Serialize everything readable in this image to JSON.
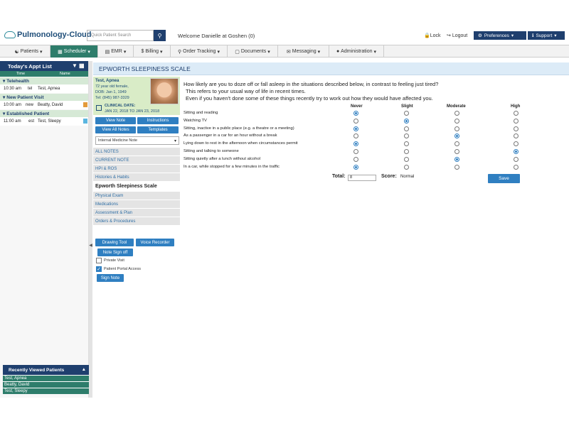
{
  "header": {
    "logo_text": "Pulmonology-Cloud",
    "search_placeholder": "Quick Patient Search",
    "welcome": "Welcome Danielle at Goshen (0)",
    "lock": "Lock",
    "logout": "Logout",
    "preferences": "Preferences",
    "support": "Support"
  },
  "nav": [
    {
      "label": "Patients",
      "icon": "patients-icon"
    },
    {
      "label": "Scheduler",
      "icon": "calendar-icon",
      "active": true
    },
    {
      "label": "EMR",
      "icon": "emr-icon"
    },
    {
      "label": "Billing",
      "icon": "dollar-icon"
    },
    {
      "label": "Order Tracking",
      "icon": "search-icon"
    },
    {
      "label": "Documents",
      "icon": "document-icon"
    },
    {
      "label": "Messaging",
      "icon": "envelope-icon"
    },
    {
      "label": "Administration",
      "icon": "user-icon"
    }
  ],
  "appointments": {
    "title": "Today's Appt List",
    "col_time": "Time",
    "col_name": "Name",
    "groups": [
      {
        "name": "Telehealth",
        "rows": [
          {
            "time": "10:30 am",
            "type": "tel",
            "name": "Test, Apnea"
          }
        ]
      },
      {
        "name": "New Patient Visit",
        "rows": [
          {
            "time": "10:00 am",
            "type": "new",
            "name": "Beatty, David"
          }
        ]
      },
      {
        "name": "Established Patient",
        "rows": [
          {
            "time": "11:00 am",
            "type": "est",
            "name": "Test, Sleepy"
          }
        ]
      }
    ]
  },
  "recent": {
    "title": "Recently Viewed Patients",
    "items": [
      "Test, Apnea",
      "Beatty, David",
      "Test, Sleepy"
    ]
  },
  "patient": {
    "name": "Test, Apnea",
    "age_sex": "72 year old female,",
    "dob": "DOB: Jan 1, 1949",
    "phone": "Tel: (845) 987-3329",
    "clinical_date_label": "CLINICAL DATE:",
    "clinical_date": "JAN 22, 2018 TO JAN 23, 2018"
  },
  "patient_buttons": {
    "view_note": "View Note",
    "instructions": "Instructions",
    "view_all_notes": "View All Notes",
    "templates": "Templates"
  },
  "note_template": "Internal Medicine Note",
  "sections": [
    "ALL NOTES",
    "CURRENT NOTE",
    "HPI & ROS",
    "Histories & Habits",
    "Epworth Sleepiness Scale",
    "Physical Exam",
    "Medications",
    "Assessment & Plan",
    "Orders & Procedures"
  ],
  "tools": {
    "drawing_tool": "Drawing Tool",
    "voice_recorder": "Voice Recorder",
    "note_sign_off": "Note Sign off",
    "private_visit": "Private Visit",
    "patient_portal_access": "Patient Portal Access",
    "sign_note": "Sign Note"
  },
  "epworth": {
    "title": "EPWORTH SLEEPINESS SCALE",
    "intro_1": "How likely are you to doze off or fall asleep in the situations described below, in contrast to feeling just tired?",
    "intro_2": "This refers to your usual way of life in recent times.",
    "intro_3": "Even if you haven't done some of these things recently try to work out how they would have affected you.",
    "columns": [
      "Never",
      "Slight",
      "Moderate",
      "High"
    ],
    "questions": [
      {
        "label": "Sitting and reading",
        "selected": 0
      },
      {
        "label": "Watching TV",
        "selected": 1
      },
      {
        "label": "Sitting, inactive in a public place (e.g. a theatre or a meeting)",
        "selected": 0
      },
      {
        "label": "As a passenger in a car for an hour without a break",
        "selected": 2
      },
      {
        "label": "Lying down to rest in the afternoon when circumstances permit",
        "selected": 0
      },
      {
        "label": "Sitting and talking to someone",
        "selected": 3
      },
      {
        "label": "Sitting quietly after a lunch without alcohol",
        "selected": 2
      },
      {
        "label": "In a car, while stopped for a few minutes in the traffic",
        "selected": 0
      }
    ],
    "total_label": "Total:",
    "total_value": "8",
    "score_label": "Score:",
    "score_value": "Normal",
    "save": "Save"
  },
  "colors": {
    "navy": "#1f3f6e",
    "teal": "#2e7d6b",
    "blue_button": "#2f7fc1",
    "patient_card_bg": "#d9ecc7"
  }
}
